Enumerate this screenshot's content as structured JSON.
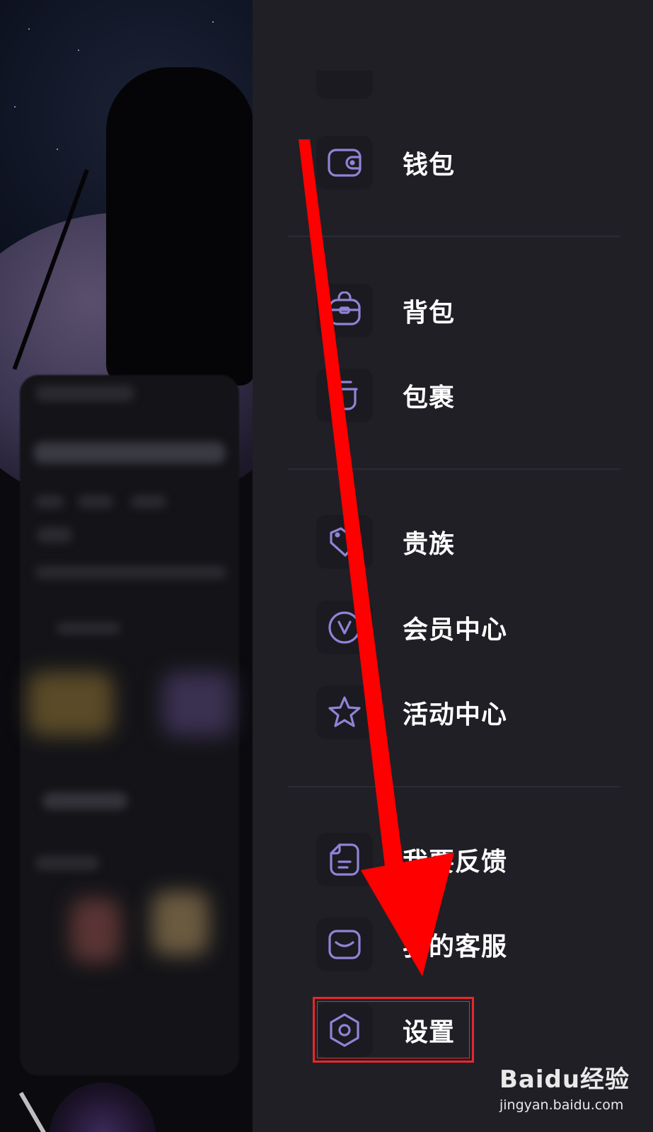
{
  "drawer": {
    "items": [
      {
        "label": "钱包",
        "icon": "wallet-icon"
      },
      {
        "label": "背包",
        "icon": "backpack-icon"
      },
      {
        "label": "包裹",
        "icon": "package-icon"
      },
      {
        "label": "贵族",
        "icon": "tag-icon"
      },
      {
        "label": "会员中心",
        "icon": "vip-v-icon"
      },
      {
        "label": "活动中心",
        "icon": "star-icon"
      },
      {
        "label": "我要反馈",
        "icon": "feedback-doc-icon"
      },
      {
        "label": "我的客服",
        "icon": "customer-service-mail-icon"
      },
      {
        "label": "设置",
        "icon": "settings-hexagon-icon"
      }
    ]
  },
  "annotation": {
    "highlight_target": "设置",
    "arrow_color": "#ff0000",
    "highlight_color": "#e8272b"
  },
  "colors": {
    "drawer_bg": "#201f26",
    "icon_bg": "#1b1a20",
    "icon_stroke": "#8f84d6",
    "label_text": "#ffffff"
  },
  "watermark": {
    "main": "Baidu经验",
    "sub": "jingyan.baidu.com"
  }
}
